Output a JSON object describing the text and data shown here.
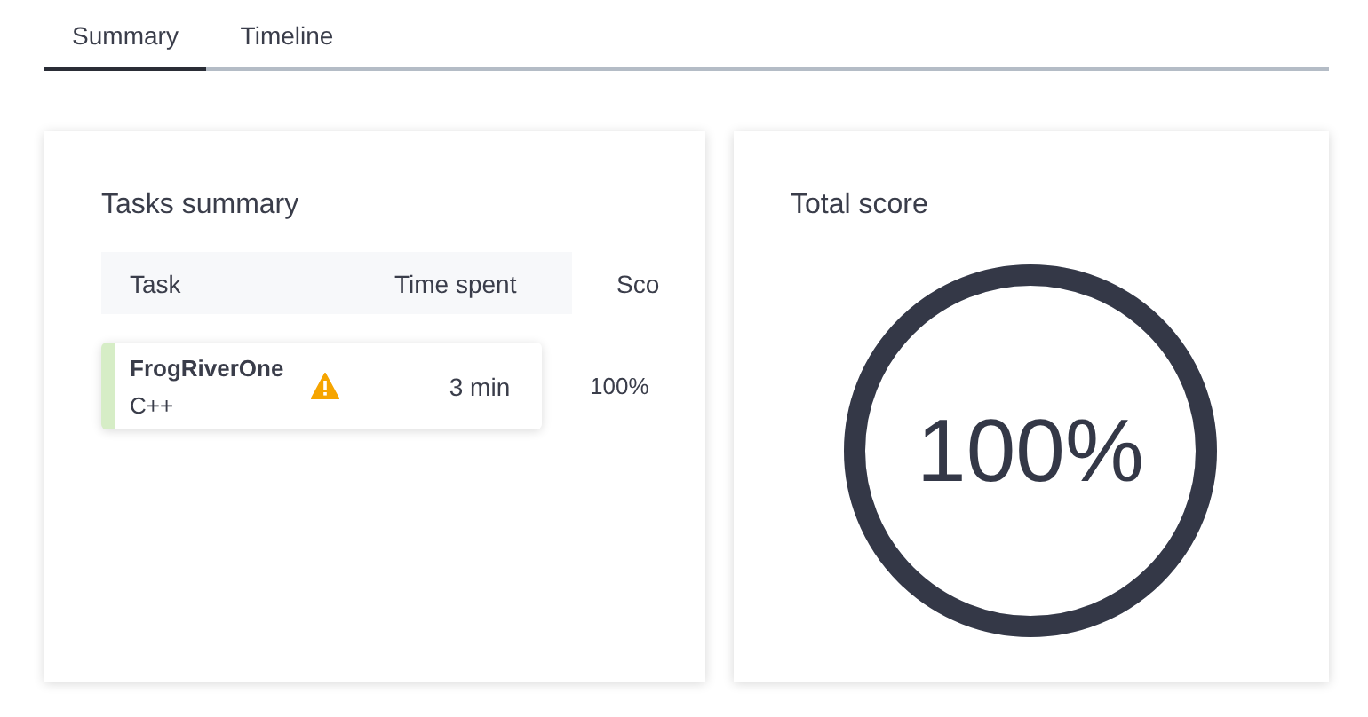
{
  "tabs": [
    {
      "label": "Summary",
      "selected": true
    },
    {
      "label": "Timeline",
      "selected": false
    }
  ],
  "tasks_summary": {
    "title": "Tasks summary",
    "columns": [
      "Task",
      "Time spent",
      "Sco"
    ],
    "rows": [
      {
        "task": "FrogRiverOne",
        "language": "C++",
        "warning": true,
        "time_spent": "3 min",
        "score": "100%"
      }
    ]
  },
  "total_score": {
    "title": "Total score",
    "value": "100%",
    "level": 1
  }
}
